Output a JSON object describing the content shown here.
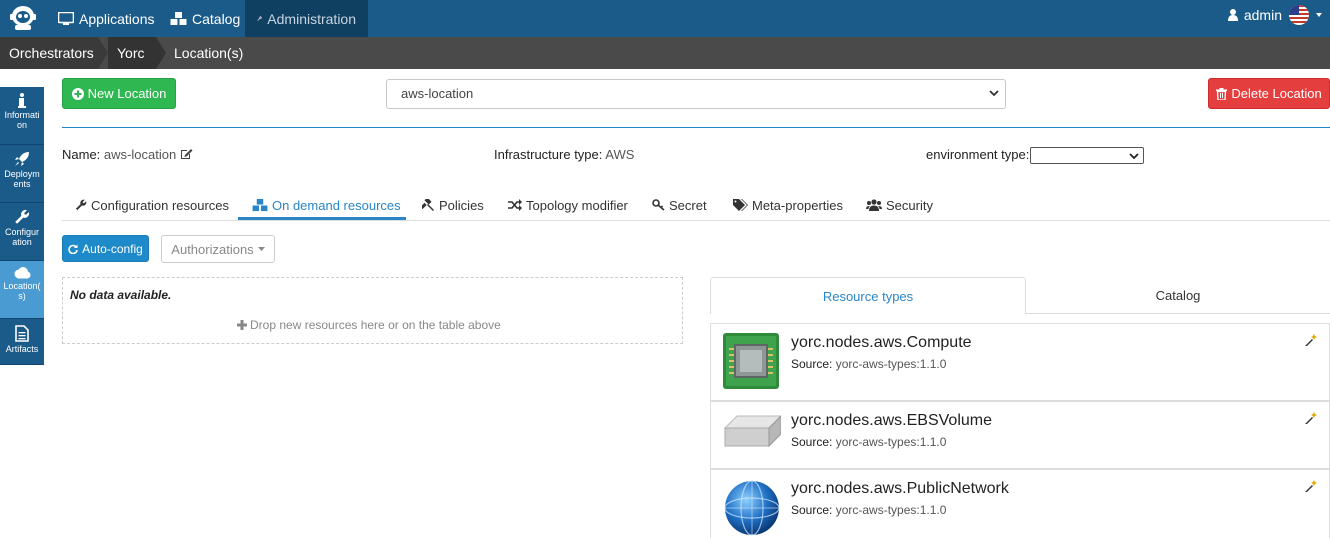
{
  "nav": {
    "applications": "Applications",
    "catalog": "Catalog",
    "administration": "Administration",
    "user": "admin"
  },
  "breadcrumb": [
    "Orchestrators",
    "Yorc",
    "Location(s)"
  ],
  "sidebar": [
    {
      "label": "Informati on",
      "icon": "info-icon"
    },
    {
      "label": "Deploym ents",
      "icon": "rocket-icon"
    },
    {
      "label": "Configur ation",
      "icon": "wrench-icon"
    },
    {
      "label": "Location( s)",
      "icon": "cloud-icon"
    },
    {
      "label": "Artifacts",
      "icon": "file-icon"
    }
  ],
  "toolbar": {
    "new_location": "New Location",
    "delete_location": "Delete Location",
    "location_select": "aws-location"
  },
  "location": {
    "name_label": "Name:",
    "name_value": "aws-location",
    "infra_label": "Infrastructure type:",
    "infra_value": "AWS",
    "env_label": "environment type:"
  },
  "tabs": [
    {
      "label": "Configuration resources",
      "icon": "wrench-icon"
    },
    {
      "label": "On demand resources",
      "icon": "cubes-icon"
    },
    {
      "label": "Policies",
      "icon": "gavel-icon"
    },
    {
      "label": "Topology modifier",
      "icon": "random-icon"
    },
    {
      "label": "Secret",
      "icon": "key-icon"
    },
    {
      "label": "Meta-properties",
      "icon": "tags-icon"
    },
    {
      "label": "Security",
      "icon": "users-icon"
    }
  ],
  "actions": {
    "auto_config": "Auto-config",
    "authorizations": "Authorizations"
  },
  "table": {
    "empty": "No data available.",
    "drop_hint": "Drop new resources here or on the table above"
  },
  "right_tabs": [
    "Resource types",
    "Catalog"
  ],
  "resources": [
    {
      "name": "yorc.nodes.aws.Compute",
      "source_label": "Source:",
      "source": "yorc-aws-types:1.1.0",
      "icon": "chip-icon"
    },
    {
      "name": "yorc.nodes.aws.EBSVolume",
      "source_label": "Source:",
      "source": "yorc-aws-types:1.1.0",
      "icon": "volume-icon"
    },
    {
      "name": "yorc.nodes.aws.PublicNetwork",
      "source_label": "Source:",
      "source": "yorc-aws-types:1.1.0",
      "icon": "globe-icon"
    }
  ],
  "colors": {
    "navbar": "#1a5b8a",
    "accent": "#2a86c7",
    "green": "#2fb751",
    "red": "#e53e3e"
  }
}
